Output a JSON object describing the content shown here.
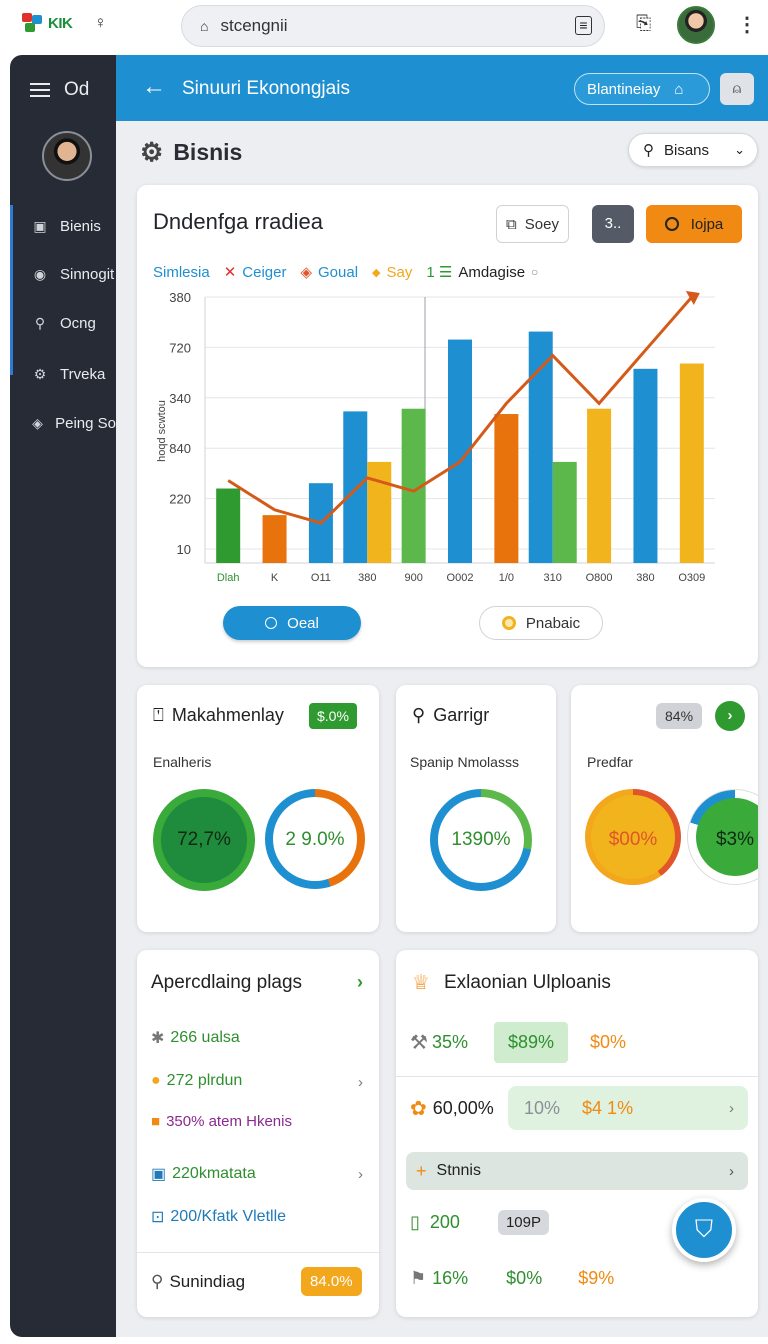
{
  "browser": {
    "brand": "KIK",
    "address": "stcengnii"
  },
  "sidebar": {
    "header": "Od",
    "items": [
      {
        "label": "Bienis",
        "icon": "square-icon"
      },
      {
        "label": "Sinnogit",
        "icon": "circle-icon"
      },
      {
        "label": "Ocng",
        "icon": "search-icon"
      },
      {
        "label": "Trveka",
        "icon": "gear-icon"
      },
      {
        "label": "Peing So",
        "icon": "shield-icon"
      }
    ]
  },
  "header": {
    "title": "Sinuuri Ekonongjais",
    "pill_label": "Blantineiay"
  },
  "section": {
    "title": "Bisnis",
    "filter_label": "Bisans"
  },
  "chart_card": {
    "title": "Dndenfga rradiea",
    "btn_outline": "Soey",
    "btn_dark": "3..",
    "btn_orange": "Iojpa",
    "legend": [
      {
        "label": "Simlesia",
        "color": "#1e8fd1",
        "marker": ""
      },
      {
        "label": "Ceiger",
        "color": "#1e8fd1",
        "marker": "✕",
        "marker_color": "#e0302a"
      },
      {
        "label": "Goual",
        "color": "#1e8fd1",
        "marker": "◈",
        "marker_color": "#e0552a"
      },
      {
        "label": "Say",
        "color": "#f2a71c",
        "marker": "◆",
        "marker_color": "#f2a71c"
      },
      {
        "label": "Amdagise",
        "color": "#222222",
        "marker": "1",
        "marker_color": "#2f9a2f"
      }
    ],
    "pill_primary": "Oeal",
    "pill_secondary": "Pnabaic"
  },
  "chart_data": {
    "type": "bar",
    "yticks": [
      "380",
      "720",
      "340",
      "840",
      "220",
      "10"
    ],
    "ylabel": "hoqd scwtou",
    "xticks": [
      "Dlah",
      "K",
      "O11",
      "380",
      "900",
      "O002",
      "1/0",
      "310",
      "O800",
      "380",
      "O309"
    ],
    "bar_scale_note": "values estimated in chart units 0-100",
    "series": [
      {
        "color": "#2f9a2f",
        "values": [
          28,
          0,
          0,
          0,
          0,
          0,
          0,
          0,
          0,
          0,
          0
        ]
      },
      {
        "color": "#e8730c",
        "values": [
          0,
          18,
          0,
          0,
          0,
          0,
          56,
          0,
          0,
          0,
          0
        ]
      },
      {
        "color": "#1e8fd1",
        "values": [
          0,
          0,
          30,
          57,
          0,
          84,
          0,
          87,
          0,
          73,
          0
        ]
      },
      {
        "color": "#f2b41c",
        "values": [
          0,
          0,
          0,
          38,
          0,
          0,
          0,
          0,
          58,
          0,
          75
        ]
      },
      {
        "color": "#5cb84a",
        "values": [
          0,
          0,
          0,
          0,
          58,
          0,
          0,
          38,
          0,
          0,
          0
        ]
      }
    ],
    "line": [
      31,
      20,
      15,
      32,
      27,
      38,
      60,
      78,
      60,
      80,
      100
    ],
    "ylim": [
      0,
      100
    ]
  },
  "metrics": [
    {
      "title": "Makahmenlay",
      "badge": "$.0%",
      "subtitle": "Enalheris",
      "donuts": [
        "72,7%",
        "2 9.0%"
      ]
    },
    {
      "title": "Garrigr",
      "subtitle": "Spanip Nmolasss",
      "donuts": [
        "1390%"
      ]
    },
    {
      "title": "",
      "badge": "84%",
      "subtitle": "Predfar",
      "donuts": [
        "$00%",
        "$3%"
      ]
    }
  ],
  "list_card": {
    "title": "Apercdlaing plags",
    "rows": [
      {
        "label": "266 ualsa",
        "color": "#2f8f2f",
        "icon": "gear-icon"
      },
      {
        "label": "272 plrdun",
        "color": "#2f8f2f",
        "icon": "coin-icon"
      },
      {
        "label": "350% atem Hkenis",
        "color": "#8a2a8f",
        "icon": "box-icon"
      },
      {
        "label": "220kmatata",
        "color": "#2f8f2f",
        "icon": "chart-icon"
      },
      {
        "label": "200/Kfatk Vletlle",
        "color": "#1e7ab8",
        "icon": "frame-icon"
      }
    ],
    "footer_label": "Sunindiag",
    "footer_badge": "84.0%"
  },
  "eu_card": {
    "title": "Exlaonian Ulploanis",
    "row1": [
      "35%",
      "$89%",
      "$0%"
    ],
    "row2": [
      "60,00%",
      "10%",
      "$4 1%"
    ],
    "row3": "Stnnis",
    "row4": [
      "200",
      "109P"
    ],
    "row5": [
      "16%",
      "$0%",
      "$9%"
    ]
  }
}
